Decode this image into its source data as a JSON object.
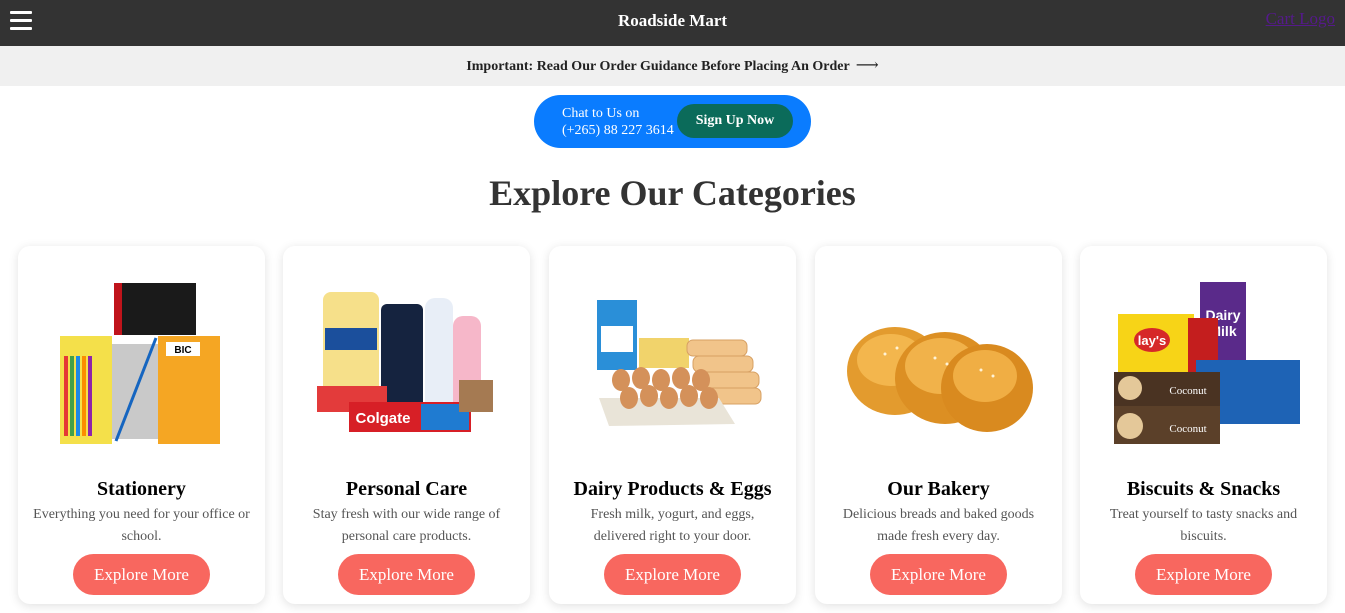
{
  "header": {
    "brand": "Roadside Mart",
    "cart_link": "Cart Logo"
  },
  "notice": {
    "text": "Important: Read Our Order Guidance Before Placing An Order",
    "arrow": "⟶"
  },
  "chat": {
    "line1": "Chat to Us on",
    "line2": "(+265) 88 227 3614",
    "signup_label": "Sign Up Now"
  },
  "section_title": "Explore Our Categories",
  "categories": [
    {
      "title": "Stationery",
      "description": "Everything you need for your office or school.",
      "button": "Explore More"
    },
    {
      "title": "Personal Care",
      "description": "Stay fresh with our wide range of personal care products.",
      "button": "Explore More"
    },
    {
      "title": "Dairy Products & Eggs",
      "description": "Fresh milk, yogurt, and eggs, delivered right to your door.",
      "button": "Explore More"
    },
    {
      "title": "Our Bakery",
      "description": "Delicious breads and baked goods made fresh every day.",
      "button": "Explore More"
    },
    {
      "title": "Biscuits & Snacks",
      "description": "Treat yourself to tasty snacks and biscuits.",
      "button": "Explore More"
    }
  ],
  "colors": {
    "topbar": "#333333",
    "notice_bg": "#f0f0f0",
    "chat_pill": "#0a7cff",
    "signup_button": "#0b6b5a",
    "explore_button": "#f8675f"
  }
}
